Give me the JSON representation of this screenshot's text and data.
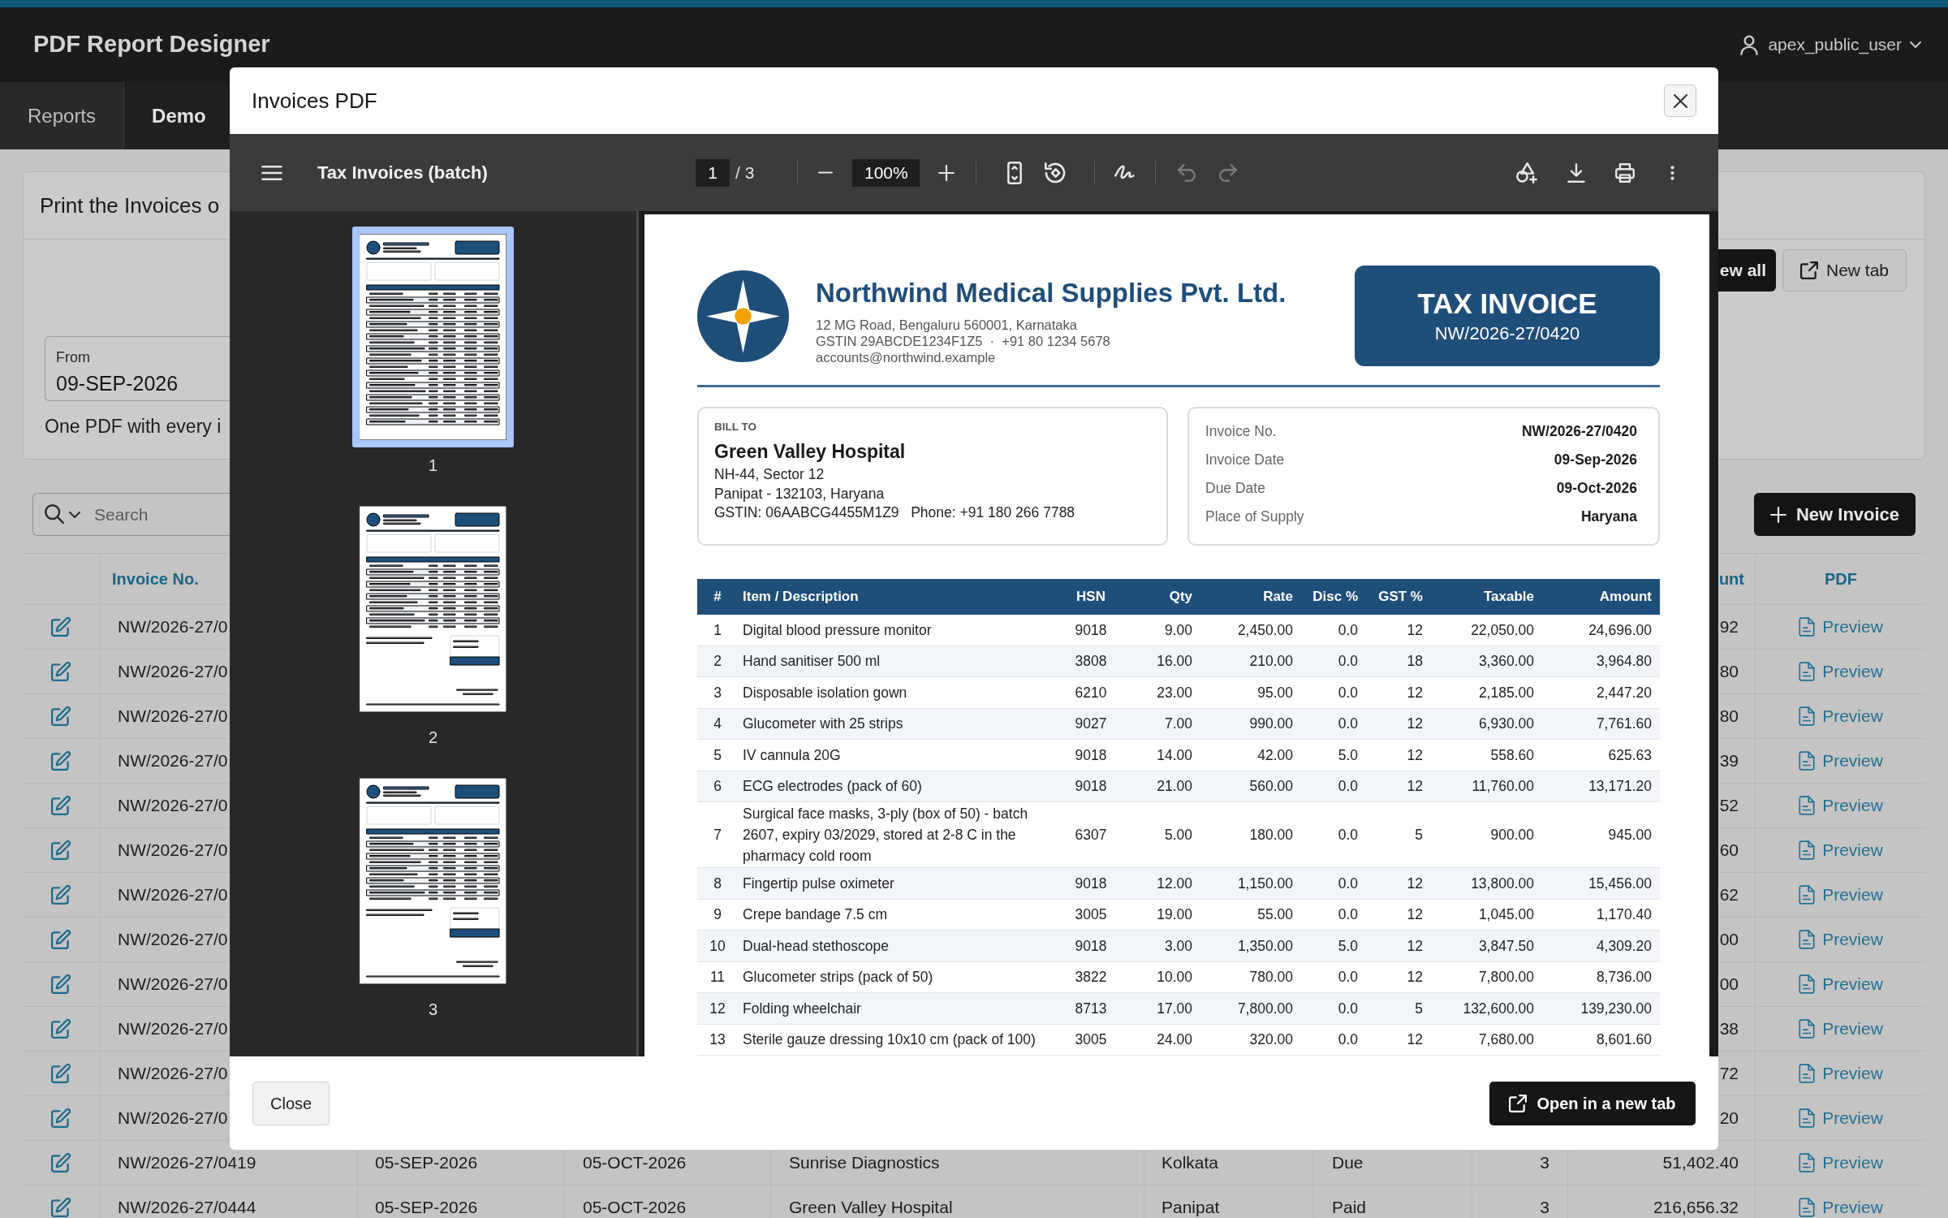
{
  "app": {
    "title": "PDF Report Designer",
    "user": "apex_public_user"
  },
  "nav_tabs": [
    {
      "label": "Reports",
      "selected": false
    },
    {
      "label": "Demo",
      "selected": true
    }
  ],
  "print_card": {
    "title": "Print the Invoices o",
    "buttons": [
      {
        "label": "ew all",
        "kind": "primary"
      },
      {
        "label": "New tab",
        "kind": "secondary"
      }
    ],
    "from_field": {
      "label": "From",
      "value": "09-SEP-2026"
    },
    "help_text": "One PDF with every i"
  },
  "list_toolbar": {
    "search_placeholder": "Search",
    "new_button": "New Invoice"
  },
  "invoices": {
    "headers": {
      "invoice_no": "Invoice No.",
      "column_9": "unt",
      "pdf": "PDF"
    },
    "rows": [
      {
        "invoice_no": "NW/2026-27/0",
        "column_9": "92",
        "pdf": "Preview"
      },
      {
        "invoice_no": "NW/2026-27/0",
        "column_9": "80",
        "pdf": "Preview"
      },
      {
        "invoice_no": "NW/2026-27/0",
        "column_9": "80",
        "pdf": "Preview"
      },
      {
        "invoice_no": "NW/2026-27/0",
        "column_9": "39",
        "pdf": "Preview"
      },
      {
        "invoice_no": "NW/2026-27/0",
        "column_9": "52",
        "pdf": "Preview"
      },
      {
        "invoice_no": "NW/2026-27/0",
        "column_9": "60",
        "pdf": "Preview"
      },
      {
        "invoice_no": "NW/2026-27/0",
        "column_9": "62",
        "pdf": "Preview"
      },
      {
        "invoice_no": "NW/2026-27/0",
        "column_9": "00",
        "pdf": "Preview"
      },
      {
        "invoice_no": "NW/2026-27/0",
        "column_9": "00",
        "pdf": "Preview"
      },
      {
        "invoice_no": "NW/2026-27/0",
        "column_9": "38",
        "pdf": "Preview"
      },
      {
        "invoice_no": "NW/2026-27/0",
        "column_9": "72",
        "pdf": "Preview"
      },
      {
        "invoice_no": "NW/2026-27/0",
        "column_9": "20",
        "pdf": "Preview"
      },
      {
        "invoice_no": "NW/2026-27/0419",
        "column_3": "05-SEP-2026",
        "column_4": "05-OCT-2026",
        "column_5": "Sunrise Diagnostics",
        "column_6": "Kolkata",
        "column_7": "Due",
        "column_8": "3",
        "column_9": "51,402.40",
        "pdf": "Preview"
      },
      {
        "invoice_no": "NW/2026-27/0444",
        "column_3": "05-SEP-2026",
        "column_4": "05-OCT-2026",
        "column_5": "Green Valley Hospital",
        "column_6": "Panipat",
        "column_7": "Paid",
        "column_8": "3",
        "column_9": "216,656.32",
        "pdf": "Preview"
      }
    ]
  },
  "dialog": {
    "title": "Invoices PDF",
    "viewer": {
      "title": "Tax Invoices (batch)",
      "page": "1",
      "page_count": "/ 3",
      "zoom": "100%",
      "history": [
        {
          "kind": "undo",
          "disabled": true
        },
        {
          "kind": "redo",
          "disabled": true
        }
      ],
      "thumbnails": [
        {
          "label": "1",
          "kind": "items",
          "selected": true
        },
        {
          "label": "2",
          "kind": "totals",
          "selected": false
        },
        {
          "label": "3",
          "kind": "totals",
          "selected": false
        }
      ]
    },
    "document": {
      "company": {
        "name": "Northwind Medical Supplies Pvt. Ltd.",
        "lines": [
          "12 MG Road, Bengaluru 560001, Karnataka",
          "GSTIN 29ABCDE1234F1Z5  ·  +91 80 1234 5678",
          "accounts@northwind.example"
        ]
      },
      "title": "TAX INVOICE",
      "number": "NW/2026-27/0420",
      "bill_to": {
        "label": "BILL TO",
        "name": "Green Valley Hospital",
        "lines": [
          "NH-44, Sector 12",
          "Panipat - 132103, Haryana",
          "GSTIN: 06AABCG4455M1Z9   Phone: +91 180 266 7788"
        ]
      },
      "details": [
        {
          "label": "Invoice No.",
          "value": "NW/2026-27/0420"
        },
        {
          "label": "Invoice Date",
          "value": "09-Sep-2026"
        },
        {
          "label": "Due Date",
          "value": "09-Oct-2026"
        },
        {
          "label": "Place of Supply",
          "value": "Haryana"
        }
      ],
      "items": {
        "columns": [
          {
            "label": "#",
            "kind": "index"
          },
          {
            "label": "Item / Description",
            "kind": "text"
          },
          {
            "label": "HSN",
            "kind": "code"
          },
          {
            "label": "Qty",
            "kind": "number"
          },
          {
            "label": "Rate",
            "kind": "number"
          },
          {
            "label": "Disc %",
            "kind": "number"
          },
          {
            "label": "GST %",
            "kind": "number"
          },
          {
            "label": "Taxable",
            "kind": "number"
          },
          {
            "label": "Amount",
            "kind": "number"
          }
        ],
        "rows": [
          [
            "1",
            "Digital blood pressure monitor",
            "9018",
            "9.00",
            "2,450.00",
            "0.0",
            "12",
            "22,050.00",
            "24,696.00"
          ],
          [
            "2",
            "Hand sanitiser 500 ml",
            "3808",
            "16.00",
            "210.00",
            "0.0",
            "18",
            "3,360.00",
            "3,964.80"
          ],
          [
            "3",
            "Disposable isolation gown",
            "6210",
            "23.00",
            "95.00",
            "0.0",
            "12",
            "2,185.00",
            "2,447.20"
          ],
          [
            "4",
            "Glucometer with 25 strips",
            "9027",
            "7.00",
            "990.00",
            "0.0",
            "12",
            "6,930.00",
            "7,761.60"
          ],
          [
            "5",
            "IV cannula 20G",
            "9018",
            "14.00",
            "42.00",
            "5.0",
            "12",
            "558.60",
            "625.63"
          ],
          [
            "6",
            "ECG electrodes (pack of 60)",
            "9018",
            "21.00",
            "560.00",
            "0.0",
            "12",
            "11,760.00",
            "13,171.20"
          ],
          [
            "7",
            "Surgical face masks, 3-ply (box of 50) - batch 2607, expiry 03/2029, stored at 2-8 C in the pharmacy cold room",
            "6307",
            "5.00",
            "180.00",
            "0.0",
            "5",
            "900.00",
            "945.00"
          ],
          [
            "8",
            "Fingertip pulse oximeter",
            "9018",
            "12.00",
            "1,150.00",
            "0.0",
            "12",
            "13,800.00",
            "15,456.00"
          ],
          [
            "9",
            "Crepe bandage 7.5 cm",
            "3005",
            "19.00",
            "55.00",
            "0.0",
            "12",
            "1,045.00",
            "1,170.40"
          ],
          [
            "10",
            "Dual-head stethoscope",
            "9018",
            "3.00",
            "1,350.00",
            "5.0",
            "12",
            "3,847.50",
            "4,309.20"
          ],
          [
            "11",
            "Glucometer strips (pack of 50)",
            "3822",
            "10.00",
            "780.00",
            "0.0",
            "12",
            "7,800.00",
            "8,736.00"
          ],
          [
            "12",
            "Folding wheelchair",
            "8713",
            "17.00",
            "7,800.00",
            "0.0",
            "5",
            "132,600.00",
            "139,230.00"
          ],
          [
            "13",
            "Sterile gauze dressing 10x10 cm (pack of 100)",
            "3005",
            "24.00",
            "320.00",
            "0.0",
            "12",
            "7,680.00",
            "8,601.60"
          ]
        ]
      }
    },
    "buttons": [
      {
        "label": "Close",
        "kind": "secondary"
      },
      {
        "label": "Open in a new tab",
        "kind": "primary"
      }
    ]
  }
}
